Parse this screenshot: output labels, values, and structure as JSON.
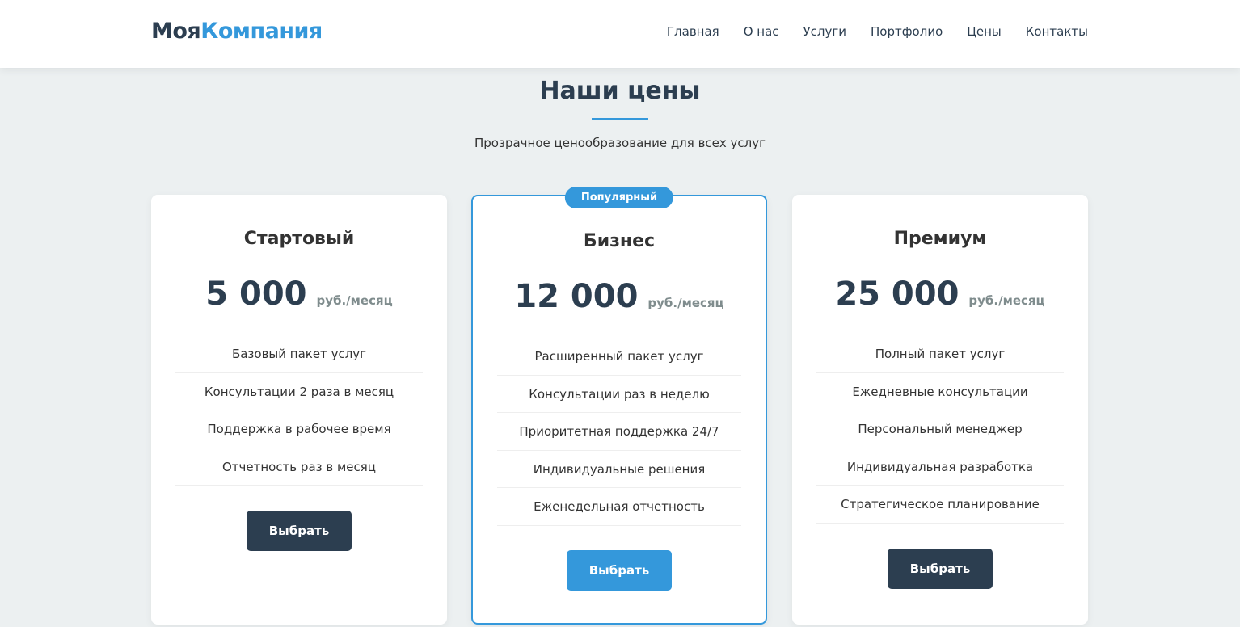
{
  "header": {
    "logo_main": "Моя",
    "logo_accent": "Компания",
    "nav": [
      "Главная",
      "О нас",
      "Услуги",
      "Портфолио",
      "Цены",
      "Контакты"
    ]
  },
  "pricing": {
    "title": "Наши цены",
    "subtitle": "Прозрачное ценообразование для всех услуг",
    "plans": [
      {
        "name": "Стартовый",
        "price": "5 000",
        "period": "руб./месяц",
        "features": [
          "Базовый пакет услуг",
          "Консультации 2 раза в месяц",
          "Поддержка в рабочее время",
          "Отчетность раз в месяц"
        ],
        "button": "Выбрать"
      },
      {
        "badge": "Популярный",
        "name": "Бизнес",
        "price": "12 000",
        "period": "руб./месяц",
        "features": [
          "Расширенный пакет услуг",
          "Консультации раз в неделю",
          "Приоритетная поддержка 24/7",
          "Индивидуальные решения",
          "Еженедельная отчетность"
        ],
        "button": "Выбрать"
      },
      {
        "name": "Премиум",
        "price": "25 000",
        "period": "руб./месяц",
        "features": [
          "Полный пакет услуг",
          "Ежедневные консультации",
          "Персональный менеджер",
          "Индивидуальная разработка",
          "Стратегическое планирование"
        ],
        "button": "Выбрать"
      }
    ]
  },
  "colors": {
    "primary": "#2c3e50",
    "accent": "#3498db",
    "background": "#ecf0f1",
    "muted": "#7f8c8d"
  }
}
